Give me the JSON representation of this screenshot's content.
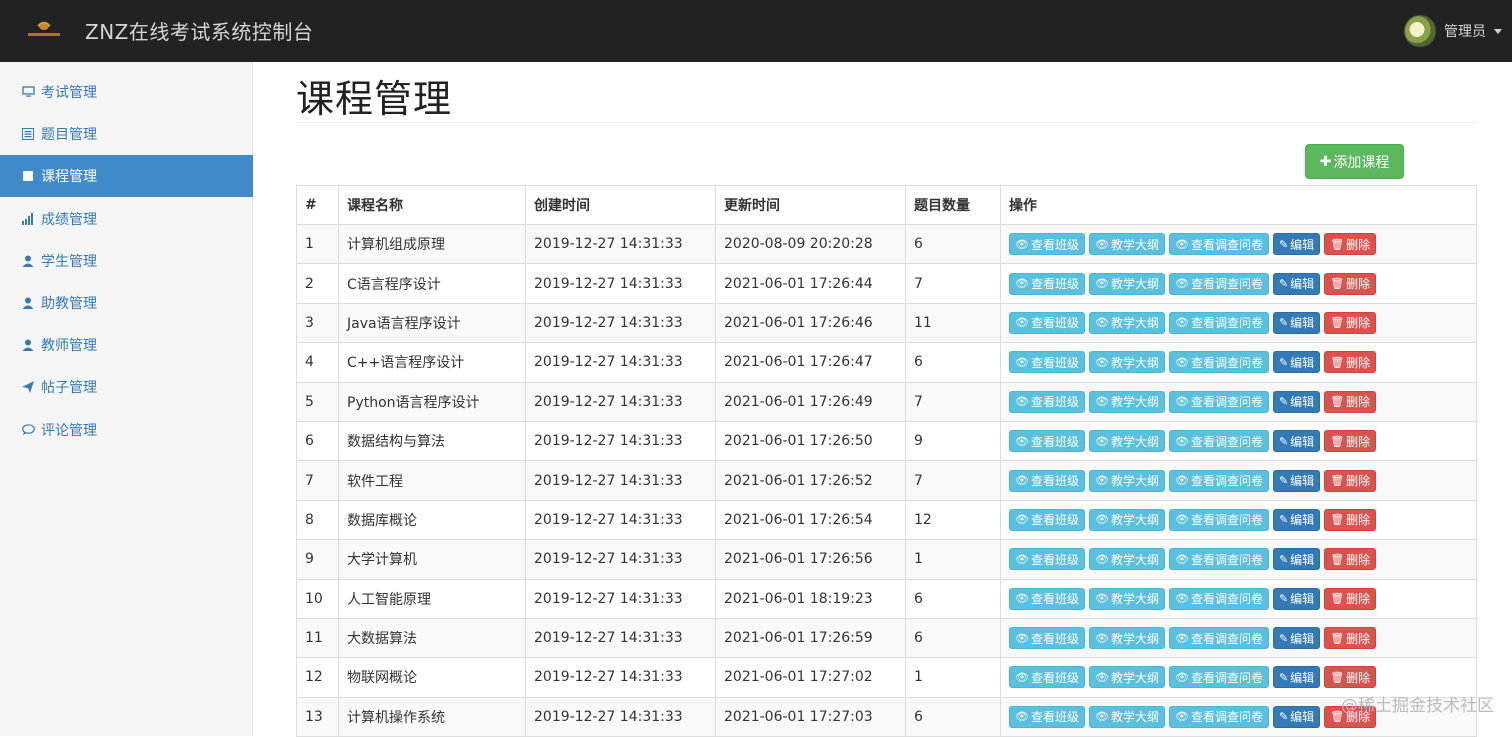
{
  "header": {
    "app_title": "ZNZ在线考试系统控制台",
    "user_label": "管理员",
    "logo_icon": "exam-system-logo"
  },
  "sidebar": {
    "items": [
      {
        "label": "考试管理",
        "icon": "monitor-icon",
        "active": false
      },
      {
        "label": "题目管理",
        "icon": "list-alt-icon",
        "active": false
      },
      {
        "label": "课程管理",
        "icon": "book-icon",
        "active": true
      },
      {
        "label": "成绩管理",
        "icon": "signal-icon",
        "active": false
      },
      {
        "label": "学生管理",
        "icon": "user-icon",
        "active": false
      },
      {
        "label": "助教管理",
        "icon": "user-icon",
        "active": false
      },
      {
        "label": "教师管理",
        "icon": "user-icon",
        "active": false
      },
      {
        "label": "帖子管理",
        "icon": "send-icon",
        "active": false
      },
      {
        "label": "评论管理",
        "icon": "comment-icon",
        "active": false
      }
    ]
  },
  "main": {
    "title": "课程管理",
    "add_button_label": "添加课程",
    "table": {
      "headers": [
        "#",
        "课程名称",
        "创建时间",
        "更新时间",
        "题目数量",
        "操作"
      ],
      "rows": [
        {
          "id": "1",
          "name": "计算机组成原理",
          "created": "2019-12-27 14:31:33",
          "updated": "2020-08-09 20:20:28",
          "count": "6"
        },
        {
          "id": "2",
          "name": "C语言程序设计",
          "created": "2019-12-27 14:31:33",
          "updated": "2021-06-01 17:26:44",
          "count": "7"
        },
        {
          "id": "3",
          "name": "Java语言程序设计",
          "created": "2019-12-27 14:31:33",
          "updated": "2021-06-01 17:26:46",
          "count": "11"
        },
        {
          "id": "4",
          "name": "C++语言程序设计",
          "created": "2019-12-27 14:31:33",
          "updated": "2021-06-01 17:26:47",
          "count": "6"
        },
        {
          "id": "5",
          "name": "Python语言程序设计",
          "created": "2019-12-27 14:31:33",
          "updated": "2021-06-01 17:26:49",
          "count": "7"
        },
        {
          "id": "6",
          "name": "数据结构与算法",
          "created": "2019-12-27 14:31:33",
          "updated": "2021-06-01 17:26:50",
          "count": "9"
        },
        {
          "id": "7",
          "name": "软件工程",
          "created": "2019-12-27 14:31:33",
          "updated": "2021-06-01 17:26:52",
          "count": "7"
        },
        {
          "id": "8",
          "name": "数据库概论",
          "created": "2019-12-27 14:31:33",
          "updated": "2021-06-01 17:26:54",
          "count": "12"
        },
        {
          "id": "9",
          "name": "大学计算机",
          "created": "2019-12-27 14:31:33",
          "updated": "2021-06-01 17:26:56",
          "count": "1"
        },
        {
          "id": "10",
          "name": "人工智能原理",
          "created": "2019-12-27 14:31:33",
          "updated": "2021-06-01 18:19:23",
          "count": "6"
        },
        {
          "id": "11",
          "name": "大数据算法",
          "created": "2019-12-27 14:31:33",
          "updated": "2021-06-01 17:26:59",
          "count": "6"
        },
        {
          "id": "12",
          "name": "物联网概论",
          "created": "2019-12-27 14:31:33",
          "updated": "2021-06-01 17:27:02",
          "count": "1"
        },
        {
          "id": "13",
          "name": "计算机操作系统",
          "created": "2019-12-27 14:31:33",
          "updated": "2021-06-01 17:27:03",
          "count": "6"
        }
      ],
      "actions": [
        {
          "label": "查看班级",
          "style": "info",
          "icon": "eye-icon",
          "glyph": "👁"
        },
        {
          "label": "教学大纲",
          "style": "info",
          "icon": "eye-icon",
          "glyph": "👁"
        },
        {
          "label": "查看调查问卷",
          "style": "info",
          "icon": "eye-icon",
          "glyph": "👁"
        },
        {
          "label": "编辑",
          "style": "primary",
          "icon": "edit-icon",
          "glyph": "✎"
        },
        {
          "label": "删除",
          "style": "danger",
          "icon": "trash-icon",
          "glyph": "🗑"
        }
      ]
    }
  },
  "watermark": "@稀土掘金技术社区",
  "colors": {
    "topbar": "#222222",
    "active_nav": "#428bca",
    "success": "#5cb85c",
    "info": "#5bc0de",
    "primary": "#337ab7",
    "danger": "#d9534f"
  }
}
